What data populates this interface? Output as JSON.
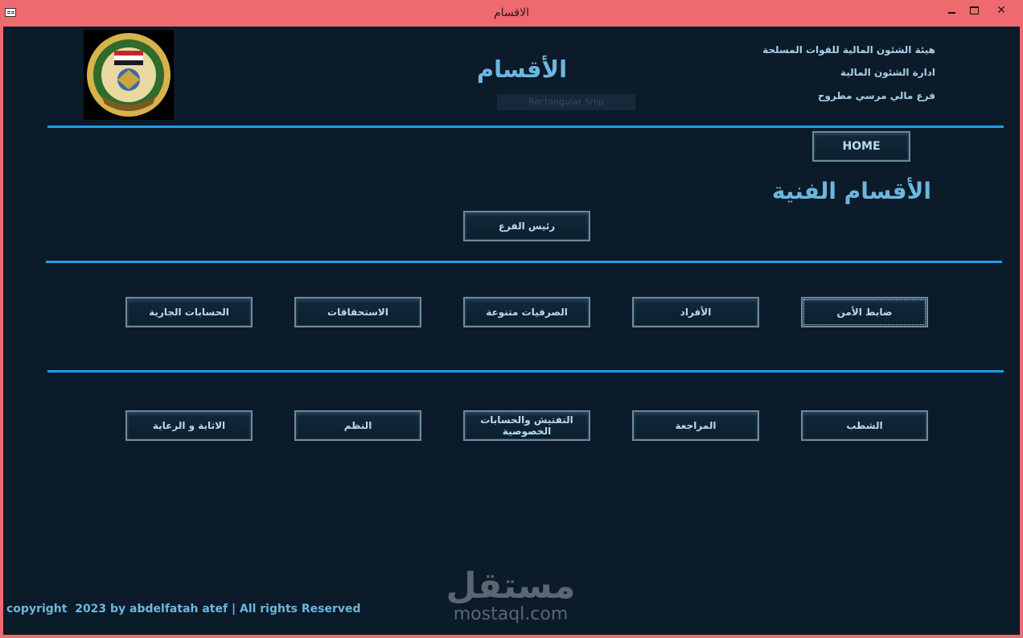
{
  "window": {
    "title": "الاقسام"
  },
  "header": {
    "org_lines": [
      "هيئة الشئون المالية للقوات المسلحة",
      "ادارة الشئون المالية",
      "فرع مالي مرسي مطروح"
    ],
    "page_title": "الأقسام",
    "logo_text": "الشئون المالية",
    "snip_label": "Rectangular Snip"
  },
  "home_button": "HOME",
  "section_title": "الأقسام الفنية",
  "branch_head_button": "رئيس الفرع",
  "row1": [
    "ضابط الأمن",
    "الأفراد",
    "الصرفيات متنوعة",
    "الاستحقاقات",
    "الحسابات الجارية"
  ],
  "row2": [
    "الشطب",
    "المراجعة",
    "التفتيش والحسابات الخصوصية",
    "النظم",
    "الاثابة و الرعاية"
  ],
  "footer": {
    "copyright": "copyright  2023 by abdelfatah atef | All rights Reserved"
  },
  "watermark": {
    "word": "مستقل",
    "domain": "mostaql.com"
  },
  "colors": {
    "background": "#0b1b29",
    "titlebar": "#ee6a6e",
    "accent_rule": "#1f9ee6",
    "heading": "#6db6de",
    "button_text": "#b9dbee"
  }
}
